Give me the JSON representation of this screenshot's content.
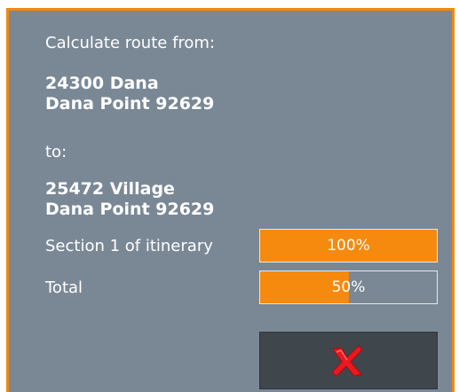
{
  "dialog": {
    "from_label": "Calculate route from:",
    "from_address": {
      "line1": "24300 Dana",
      "line2": "Dana Point 92629"
    },
    "to_label": "to:",
    "to_address": {
      "line1": "25472 Village",
      "line2": "Dana Point 92629"
    },
    "progress": [
      {
        "label": "Section 1 of itinerary",
        "value_text": "100%",
        "fraction": 1.0
      },
      {
        "label": "Total",
        "value_text": "50%",
        "fraction": 0.5
      }
    ],
    "cancel_icon": "red-x-icon"
  },
  "colors": {
    "accent": "#ef8a10",
    "panel": "#7a8896",
    "button": "#3f464c",
    "icon": "#e8191f"
  }
}
